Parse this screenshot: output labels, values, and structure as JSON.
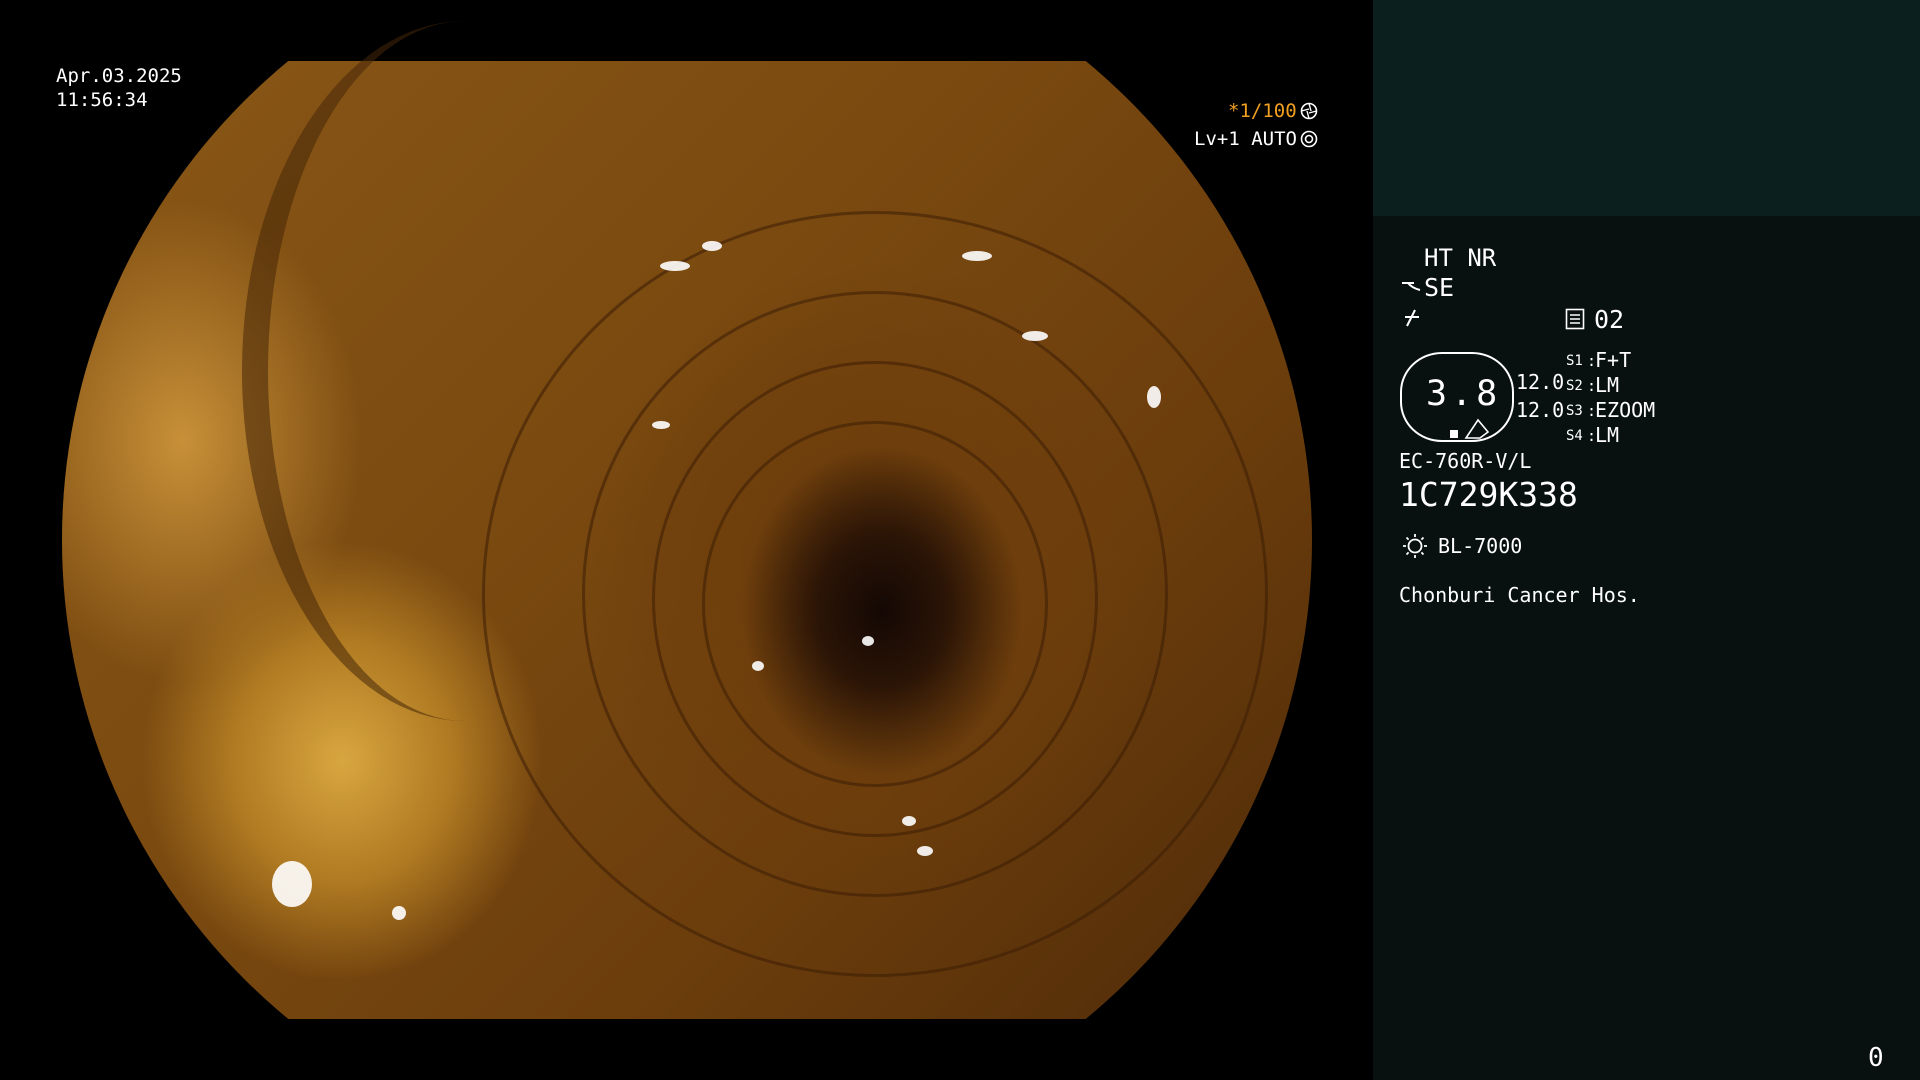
{
  "overlay": {
    "date": "Apr.03.2025",
    "time": "11:56:34",
    "shutter": "*1/100",
    "shutter_icon": "aperture-icon",
    "exposure": "Lv+1 AUTO",
    "exposure_icon": "iris-icon"
  },
  "panel": {
    "mode_line": "HT NR",
    "se_label": "SE",
    "memory_value": "02",
    "zoom_value": "3.8",
    "zoom_level_1": "12.0",
    "zoom_level_2": "12.0",
    "switches": [
      {
        "key": "S1",
        "value": "F+T"
      },
      {
        "key": "S2",
        "value": "LM"
      },
      {
        "key": "S3",
        "value": "EZOOM"
      },
      {
        "key": "S4",
        "value": "LM"
      }
    ],
    "scope_model": "EC-760R-V/L",
    "serial": "1C729K338",
    "light_source": "BL-7000",
    "hospital": "Chonburi Cancer Hos.",
    "counter": "0"
  },
  "colors": {
    "accent_orange": "#f0a020",
    "panel_bg": "#081010",
    "panel_top_bg": "#0b1f1f"
  }
}
